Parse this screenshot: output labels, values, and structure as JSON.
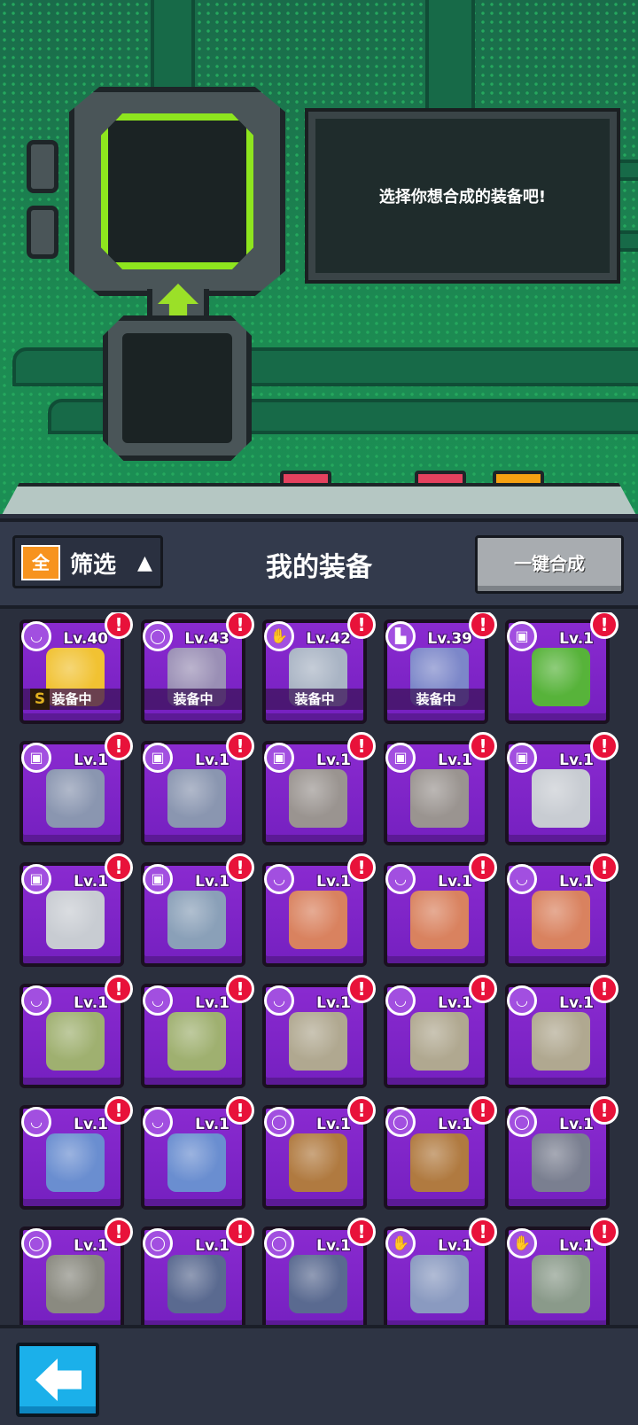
{
  "synth": {
    "prompt": "选择你想合成的装备吧!"
  },
  "header": {
    "filter_badge": "全",
    "filter_label": "筛选",
    "filter_caret": "▲",
    "title": "我的装备",
    "merge_button": "一键合成"
  },
  "colors": {
    "card_purple": "#8a2ad0",
    "alert_red": "#e8123a",
    "accent_green": "#8ee51e",
    "filter_orange": "#f7931e",
    "back_blue": "#1bb0ea"
  },
  "items": [
    {
      "type": "necklace-icon",
      "level": "Lv.40",
      "equipped": "装备中",
      "grade": "S",
      "art": "#f1c232"
    },
    {
      "type": "belt-icon",
      "level": "Lv.43",
      "equipped": "装备中",
      "art": "#9a8fb5"
    },
    {
      "type": "glove-icon",
      "level": "Lv.42",
      "equipped": "装备中",
      "art": "#a9b4c4"
    },
    {
      "type": "boot-icon",
      "level": "Lv.39",
      "equipped": "装备中",
      "art": "#7c87c9"
    },
    {
      "type": "armor-icon",
      "level": "Lv.1",
      "art": "#57b33a"
    },
    {
      "type": "armor-icon",
      "level": "Lv.1",
      "art": "#8a96b0"
    },
    {
      "type": "armor-icon",
      "level": "Lv.1",
      "art": "#8a96b0"
    },
    {
      "type": "armor-icon",
      "level": "Lv.1",
      "art": "#9a9490"
    },
    {
      "type": "armor-icon",
      "level": "Lv.1",
      "art": "#9a9490"
    },
    {
      "type": "armor-icon",
      "level": "Lv.1",
      "art": "#c8ccd2"
    },
    {
      "type": "armor-icon",
      "level": "Lv.1",
      "art": "#c8ccd2"
    },
    {
      "type": "armor-icon",
      "level": "Lv.1",
      "art": "#8aa0b8"
    },
    {
      "type": "necklace-icon",
      "level": "Lv.1",
      "art": "#d9825f"
    },
    {
      "type": "necklace-icon",
      "level": "Lv.1",
      "art": "#d9825f"
    },
    {
      "type": "necklace-icon",
      "level": "Lv.1",
      "art": "#d9825f"
    },
    {
      "type": "necklace-icon",
      "level": "Lv.1",
      "art": "#9fb070"
    },
    {
      "type": "necklace-icon",
      "level": "Lv.1",
      "art": "#9fb070"
    },
    {
      "type": "necklace-icon",
      "level": "Lv.1",
      "art": "#b0a890"
    },
    {
      "type": "necklace-icon",
      "level": "Lv.1",
      "art": "#b0a890"
    },
    {
      "type": "necklace-icon",
      "level": "Lv.1",
      "art": "#b0a890"
    },
    {
      "type": "necklace-icon",
      "level": "Lv.1",
      "art": "#6a8ed0"
    },
    {
      "type": "necklace-icon",
      "level": "Lv.1",
      "art": "#6a8ed0"
    },
    {
      "type": "belt-icon",
      "level": "Lv.1",
      "art": "#b07a40"
    },
    {
      "type": "belt-icon",
      "level": "Lv.1",
      "art": "#b07a40"
    },
    {
      "type": "belt-icon",
      "level": "Lv.1",
      "art": "#7a7f90"
    },
    {
      "type": "belt-icon",
      "level": "Lv.1",
      "art": "#8a8a80"
    },
    {
      "type": "belt-icon",
      "level": "Lv.1",
      "art": "#5a6a90"
    },
    {
      "type": "belt-icon",
      "level": "Lv.1",
      "art": "#5a6a90"
    },
    {
      "type": "glove-icon",
      "level": "Lv.1",
      "art": "#8a9ac0"
    },
    {
      "type": "glove-icon",
      "level": "Lv.1",
      "art": "#8a9a8a"
    }
  ],
  "alert_mark": "!",
  "footer": {
    "back_icon": "back-arrow-icon"
  }
}
